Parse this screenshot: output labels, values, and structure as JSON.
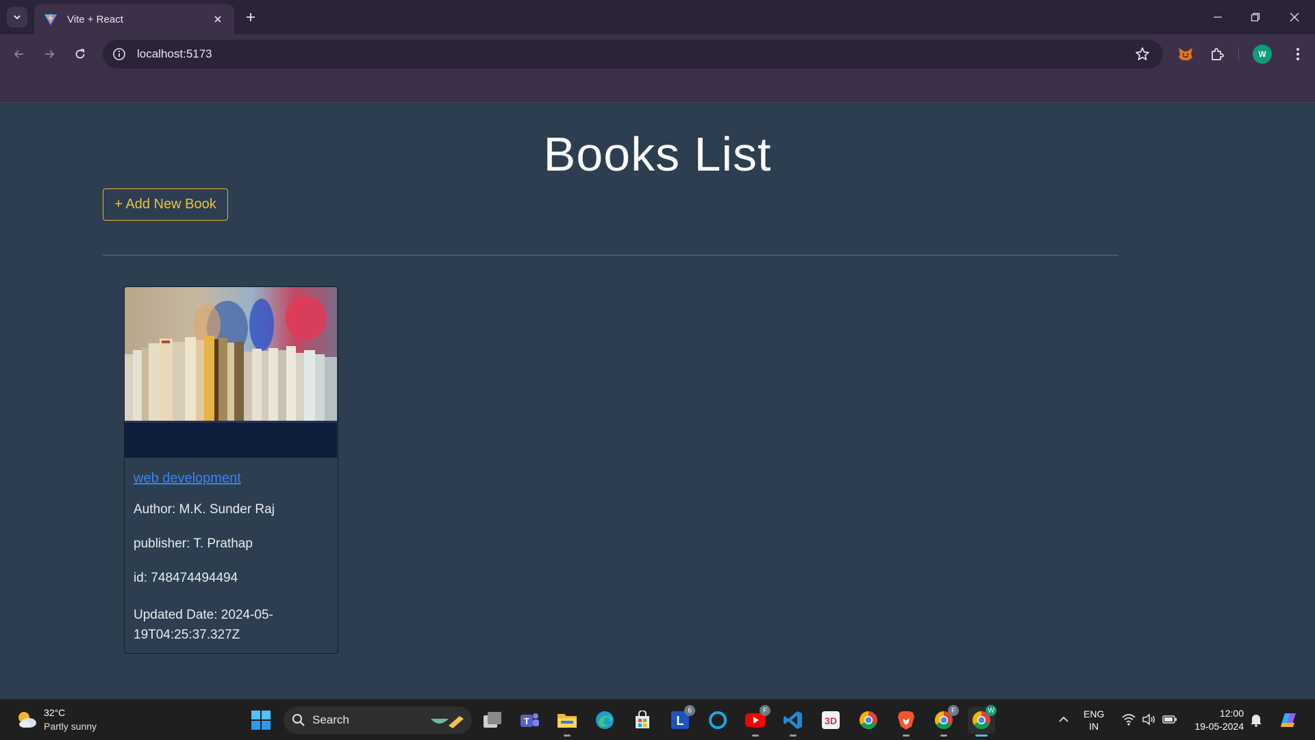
{
  "browser": {
    "tab_title": "Vite + React",
    "url": "localhost:5173",
    "profile_initial": "W"
  },
  "page": {
    "title": "Books List",
    "add_button_label": "+ Add New Book"
  },
  "books": [
    {
      "title": "web development",
      "author": "Author: M.K. Sunder Raj",
      "publisher": "publisher: T. Prathap",
      "id": "id: 748474494494",
      "updated": "Updated Date: 2024-05-19T04:25:37.327Z"
    }
  ],
  "taskbar": {
    "weather_temp": "32°C",
    "weather_desc": "Partly sunny",
    "search_label": "Search",
    "lang_top": "ENG",
    "lang_bottom": "IN",
    "time": "12:00",
    "date": "19-05-2024",
    "store_badge": "6",
    "youtube_badge": "F",
    "chrome2_badge": "F",
    "chrome3_badge": "W"
  }
}
